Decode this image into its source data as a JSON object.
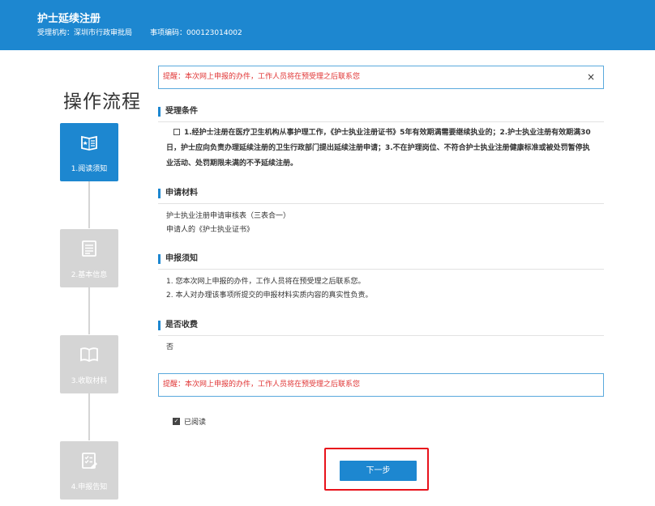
{
  "header": {
    "title": "护士延续注册",
    "agency_label": "受理机构：",
    "agency_value": "深圳市行政审批局",
    "item_code_label": "事项编码：",
    "item_code_value": "000123014002"
  },
  "flow": {
    "title": "操作流程",
    "steps": [
      {
        "label": "1.阅读须知",
        "icon": "read-notice-icon",
        "active": true
      },
      {
        "label": "2.基本信息",
        "icon": "document-list-icon",
        "active": false
      },
      {
        "label": "3.收取材料",
        "icon": "open-book-icon",
        "active": false
      },
      {
        "label": "4.申报告知",
        "icon": "checklist-edit-icon",
        "active": false
      }
    ]
  },
  "notice_top": {
    "text": "提醒：本次网上申报的办件，工作人员将在预受理之后联系您",
    "close": "×"
  },
  "sections": {
    "conditions": {
      "title": "受理条件",
      "text": "1.经护士注册在医疗卫生机构从事护理工作，《护士执业注册证书》5年有效期满需要继续执业的；2.护士执业注册有效期满30日，护士应向负责办理延续注册的卫生行政部门提出延续注册申请；3.不在护理岗位、不符合护士执业注册健康标准或被处罚暂停执业活动、处罚期限未满的不予延续注册。"
    },
    "materials": {
      "title": "申请材料",
      "items": [
        "护士执业注册申请审核表（三表合一）",
        "申请人的《护士执业证书》"
      ]
    },
    "declaration": {
      "title": "申报须知",
      "items": [
        "1. 您本次网上申报的办件，工作人员将在预受理之后联系您。",
        "2. 本人对办理该事项所提交的申报材料实质内容的真实性负责。"
      ]
    },
    "fee": {
      "title": "是否收费",
      "value": "否"
    }
  },
  "notice_bottom": {
    "text": "提醒：本次网上申报的办件，工作人员将在预受理之后联系您"
  },
  "read_confirm": {
    "label": "已阅读",
    "checked": true
  },
  "next_button": {
    "label": "下一步"
  },
  "colors": {
    "primary": "#1d87d0",
    "inactive": "#d5d5d5",
    "alert": "#e03434",
    "highlight": "#e8121b"
  }
}
